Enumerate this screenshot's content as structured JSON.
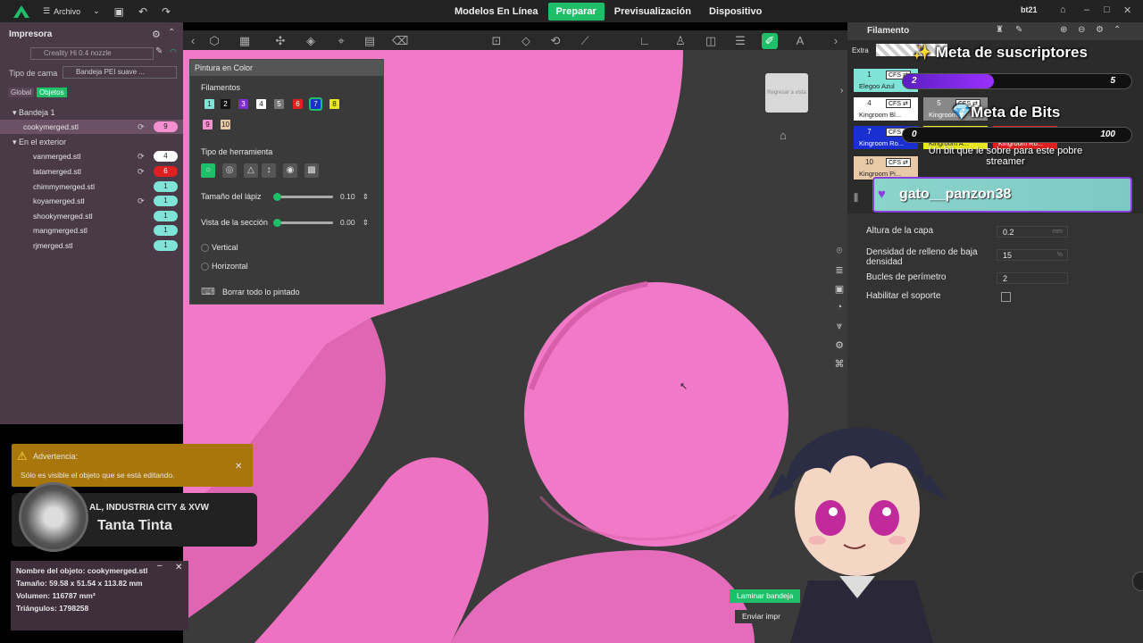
{
  "app": {
    "file_menu": "Archivo",
    "user": "bt21"
  },
  "tabs": [
    {
      "label": "Modelos En Línea"
    },
    {
      "label": "Preparar"
    },
    {
      "label": "Previsualización"
    },
    {
      "label": "Dispositivo"
    }
  ],
  "left_panel": {
    "title": "Impresora",
    "printer": "Creality Hi 0.4 nozzle",
    "bed_label": "Tipo de cama",
    "bed_value": "Bandeja PEI suave ...",
    "tab_global": "Global",
    "tab_objects": "Objetos",
    "plate": "Bandeja 1",
    "outside": "En el exterior",
    "objects": [
      {
        "name": "cookymerged.stl",
        "badge": "9",
        "color": "#f48fd0"
      },
      {
        "name": "vanmerged.stl",
        "badge": "4",
        "color": "#ffffff"
      },
      {
        "name": "tatamerged.stl",
        "badge": "6",
        "color": "#e02020"
      },
      {
        "name": "chimmymerged.stl",
        "badge": "1",
        "color": "#7fe3d8"
      },
      {
        "name": "koyamerged.stl",
        "badge": "1",
        "color": "#7fe3d8"
      },
      {
        "name": "shookymerged.stl",
        "badge": "1",
        "color": "#7fe3d8"
      },
      {
        "name": "mangmerged.stl",
        "badge": "1",
        "color": "#7fe3d8"
      },
      {
        "name": "rjmerged.stl",
        "badge": "1",
        "color": "#7fe3d8"
      }
    ]
  },
  "paint": {
    "title": "Pintura en Color",
    "filaments_label": "Filamentos",
    "swatches": [
      {
        "n": "1",
        "c": "#7fe3d8"
      },
      {
        "n": "2",
        "c": "#111111"
      },
      {
        "n": "3",
        "c": "#7a2fd0"
      },
      {
        "n": "4",
        "c": "#ffffff"
      },
      {
        "n": "5",
        "c": "#777777"
      },
      {
        "n": "6",
        "c": "#e02020"
      },
      {
        "n": "7",
        "c": "#1a2fd0"
      },
      {
        "n": "8",
        "c": "#e8e820"
      },
      {
        "n": "9",
        "c": "#f48fd0"
      },
      {
        "n": "10",
        "c": "#e8c9a8"
      }
    ],
    "tool_type_label": "Tipo de herramienta",
    "pencil_size_label": "Tamaño del lápiz",
    "pencil_size_value": "0.10",
    "section_view_label": "Vista de la sección",
    "section_view_value": "0.00",
    "vertical": "Vertical",
    "horizontal": "Horizontal",
    "clear_all": "Borrar todo lo pintado"
  },
  "right_panel": {
    "title": "Filamento",
    "extra": "Extra",
    "filaments": [
      {
        "n": "1",
        "name": "Elegoo Azul",
        "color": "#7fe3d8"
      },
      {
        "n": "4",
        "name": "Kingroom Bl...",
        "color": "#ffffff"
      },
      {
        "n": "5",
        "name": "Kingroom...",
        "color": "#888888"
      },
      {
        "n": "7",
        "name": "Kingroom Ro...",
        "color": "#1a2fd0"
      },
      {
        "n": "8",
        "name": "Kingroom A...",
        "color": "#e8e820"
      },
      {
        "n": "9",
        "name": "Kingroom Ro...",
        "color": "#e02020"
      },
      {
        "n": "10",
        "name": "Kingroom Pi...",
        "color": "#e8c9a8"
      }
    ],
    "cfs": "CFS ⇄",
    "settings": [
      {
        "label": "Altura de la capa",
        "value": "0.2",
        "unit": "mm"
      },
      {
        "label": "Densidad de relleno de baja densidad",
        "value": "15",
        "unit": "%"
      },
      {
        "label": "Bucles de perímetro",
        "value": "2",
        "unit": ""
      },
      {
        "label": "Habilitar el soporte",
        "value": "",
        "unit": ""
      }
    ]
  },
  "overlay": {
    "subs_goal_title": "Meta de suscriptores",
    "subs_current": "2",
    "subs_target": "5",
    "subs_progress": 0.4,
    "bits_goal_title": "Meta de Bits",
    "bits_current": "0",
    "bits_target": "100",
    "bits_subtitle": "Un bit que le sobre para este pobre streamer",
    "viewer": "gato__panzon38",
    "now_playing_artist": "AL, INDUSTRIA CITY & XVW",
    "now_playing_title": "Tanta Tinta"
  },
  "warning": {
    "title": "Advertencia:",
    "text": "Sólo es visible el objeto que se está editando."
  },
  "object_info": {
    "name": "Nombre del objeto: cookymerged.stl",
    "size": "Tamaño: 59.58 x 51.54 x 113.82 mm",
    "volume": "Volumen: 116787 mm³",
    "triangles": "Triángulos: 1798258"
  },
  "actions": {
    "slice": "Laminar bandeja",
    "send": "Enviar impr"
  },
  "view_cube": "Regresar a vista",
  "colors": {
    "accent": "#1fbf6a",
    "model_pink": "#f07ac8",
    "panel_purple": "#4a3a48"
  }
}
